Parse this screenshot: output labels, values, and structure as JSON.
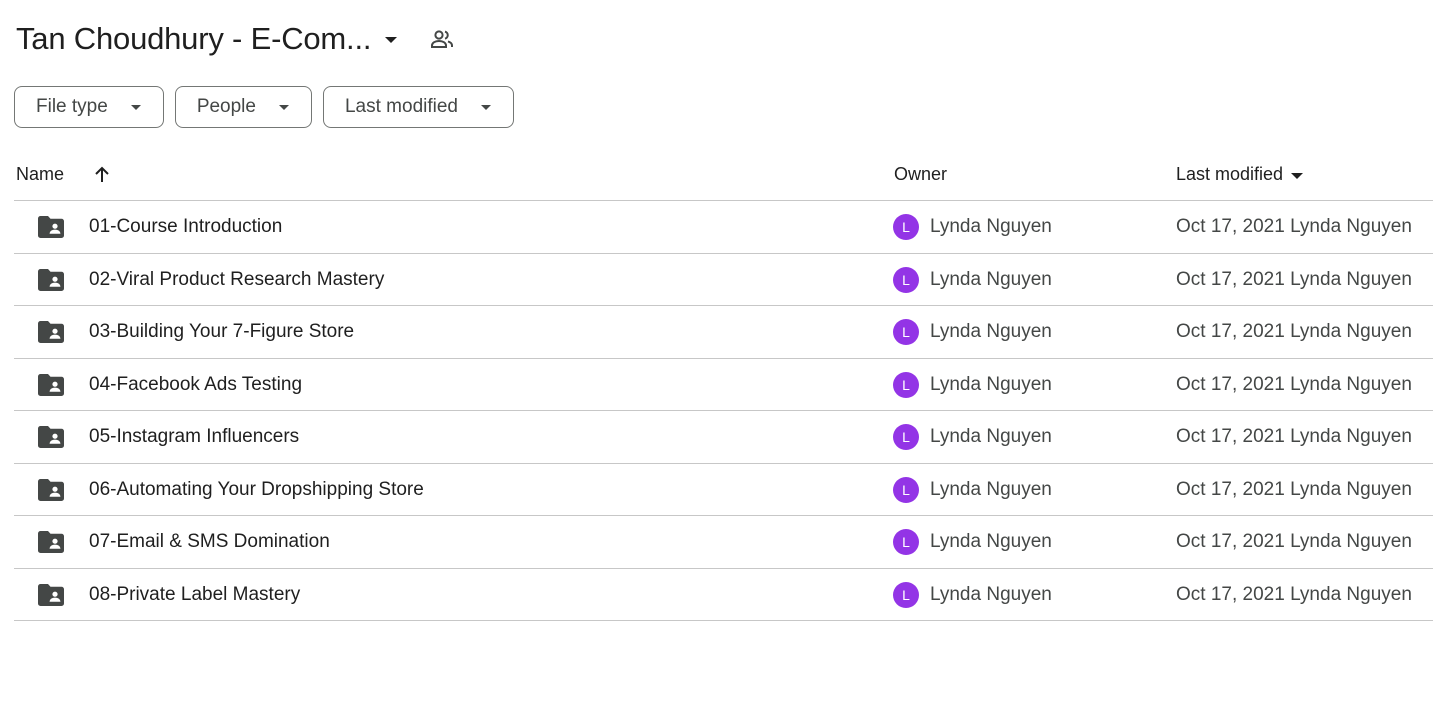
{
  "header": {
    "title": "Tan Choudhury - E-Com...",
    "share_icon": "people-icon"
  },
  "filters": [
    {
      "label": "File type"
    },
    {
      "label": "People"
    },
    {
      "label": "Last modified"
    }
  ],
  "columns": {
    "name": "Name",
    "owner": "Owner",
    "last_modified": "Last modified"
  },
  "rows": [
    {
      "name": "01-Course Introduction",
      "owner_initial": "L",
      "owner": "Lynda Nguyen",
      "modified": "Oct 17, 2021 Lynda Nguyen"
    },
    {
      "name": "02-Viral Product Research Mastery",
      "owner_initial": "L",
      "owner": "Lynda Nguyen",
      "modified": "Oct 17, 2021 Lynda Nguyen"
    },
    {
      "name": "03-Building Your 7-Figure Store",
      "owner_initial": "L",
      "owner": "Lynda Nguyen",
      "modified": "Oct 17, 2021 Lynda Nguyen"
    },
    {
      "name": "04-Facebook Ads Testing",
      "owner_initial": "L",
      "owner": "Lynda Nguyen",
      "modified": "Oct 17, 2021 Lynda Nguyen"
    },
    {
      "name": "05-Instagram Influencers",
      "owner_initial": "L",
      "owner": "Lynda Nguyen",
      "modified": "Oct 17, 2021 Lynda Nguyen"
    },
    {
      "name": "06-Automating Your Dropshipping Store",
      "owner_initial": "L",
      "owner": "Lynda Nguyen",
      "modified": "Oct 17, 2021 Lynda Nguyen"
    },
    {
      "name": "07-Email & SMS Domination",
      "owner_initial": "L",
      "owner": "Lynda Nguyen",
      "modified": "Oct 17, 2021 Lynda Nguyen"
    },
    {
      "name": "08-Private Label Mastery",
      "owner_initial": "L",
      "owner": "Lynda Nguyen",
      "modified": "Oct 17, 2021 Lynda Nguyen"
    }
  ],
  "colors": {
    "avatar": "#9334e6",
    "divider": "#c7c7c7",
    "text_primary": "#1f1f1f",
    "text_secondary": "#444746"
  }
}
